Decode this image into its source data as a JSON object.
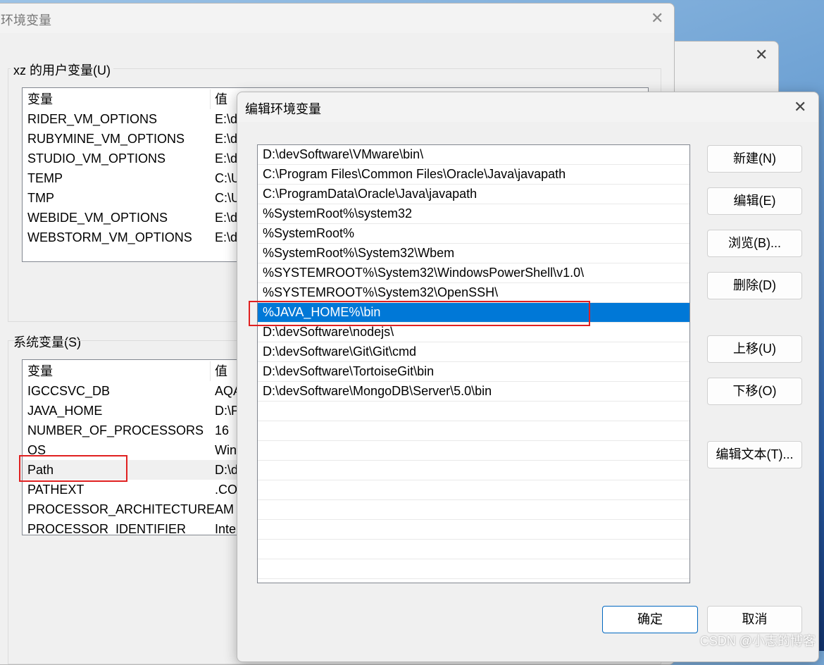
{
  "env_window": {
    "title": "环境变量",
    "user_group": {
      "label": "xz 的用户变量(U)",
      "headers": [
        "变量",
        "值"
      ],
      "rows": [
        [
          "RIDER_VM_OPTIONS",
          "E:\\d"
        ],
        [
          "RUBYMINE_VM_OPTIONS",
          "E:\\d"
        ],
        [
          "STUDIO_VM_OPTIONS",
          "E:\\d"
        ],
        [
          "TEMP",
          "C:\\U"
        ],
        [
          "TMP",
          "C:\\U"
        ],
        [
          "WEBIDE_VM_OPTIONS",
          "E:\\d"
        ],
        [
          "WEBSTORM_VM_OPTIONS",
          "E:\\d"
        ]
      ]
    },
    "system_group": {
      "label": "系统变量(S)",
      "headers": [
        "变量",
        "值"
      ],
      "rows": [
        [
          "IGCCSVC_DB",
          "AQA"
        ],
        [
          "JAVA_HOME",
          "D:\\P"
        ],
        [
          "NUMBER_OF_PROCESSORS",
          "16"
        ],
        [
          "OS",
          "Win"
        ],
        [
          "Path",
          "D:\\d"
        ],
        [
          "PATHEXT",
          ".CO"
        ],
        [
          "PROCESSOR_ARCHITECTURE",
          "AM"
        ],
        [
          "PROCESSOR_IDENTIFIER",
          "Inte"
        ]
      ],
      "selected": "Path"
    }
  },
  "edit_dialog": {
    "title": "编辑环境变量",
    "entries": [
      "D:\\devSoftware\\VMware\\bin\\",
      "C:\\Program Files\\Common Files\\Oracle\\Java\\javapath",
      "C:\\ProgramData\\Oracle\\Java\\javapath",
      "%SystemRoot%\\system32",
      "%SystemRoot%",
      "%SystemRoot%\\System32\\Wbem",
      "%SYSTEMROOT%\\System32\\WindowsPowerShell\\v1.0\\",
      "%SYSTEMROOT%\\System32\\OpenSSH\\",
      "%JAVA_HOME%\\bin",
      "D:\\devSoftware\\nodejs\\",
      "D:\\devSoftware\\Git\\Git\\cmd",
      "D:\\devSoftware\\TortoiseGit\\bin",
      "D:\\devSoftware\\MongoDB\\Server\\5.0\\bin"
    ],
    "selected": "%JAVA_HOME%\\bin",
    "buttons": {
      "new": "新建(N)",
      "edit": "编辑(E)",
      "browse": "浏览(B)...",
      "delete": "删除(D)",
      "up": "上移(U)",
      "down": "下移(O)",
      "edit_text": "编辑文本(T)...",
      "ok": "确定",
      "cancel": "取消"
    }
  },
  "watermark": "CSDN @小志的博客",
  "colors": {
    "selection": "#0078d7",
    "highlight_box": "#e02020"
  }
}
